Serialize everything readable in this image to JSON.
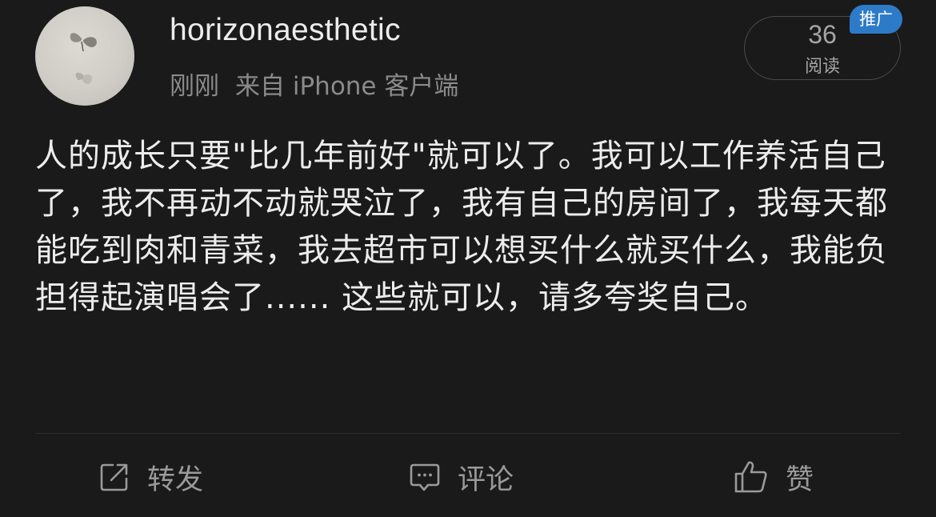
{
  "post": {
    "username": "horizonaesthetic",
    "time": "刚刚",
    "source_prefix": "来自",
    "source_device": "iPhone 客户端",
    "read_count": "36",
    "read_label": "阅读",
    "promo_tag": "推广",
    "content": "人的成长只要\"比几年前好\"就可以了。我可以工作养活自己了，我不再动不动就哭泣了，我有自己的房间了，我每天都能吃到肉和青菜，我去超市可以想买什么就买什么，我能负担得起演唱会了...... 这些就可以，请多夸奖自己。"
  },
  "actions": {
    "repost_label": "转发",
    "comment_label": "评论",
    "like_label": "赞"
  },
  "icons": {
    "repost": "share-icon",
    "comment": "comment-icon",
    "like": "thumbs-up-icon"
  },
  "colors": {
    "background": "#1a1a1a",
    "promo_tag": "#2d7bc8",
    "secondary_text": "#8a8a8a"
  }
}
